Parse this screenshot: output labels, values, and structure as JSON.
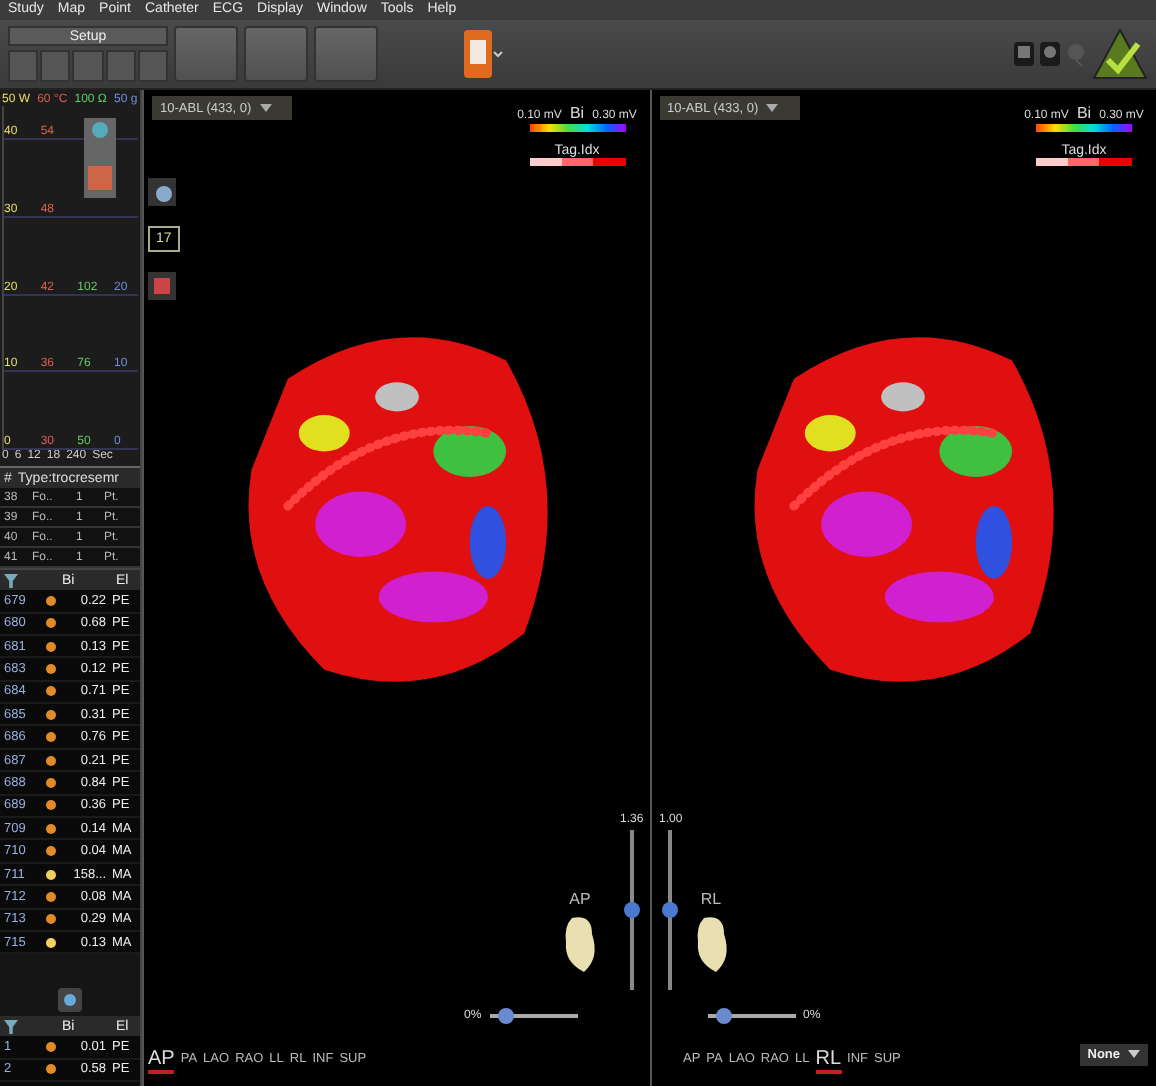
{
  "menu": [
    "Study",
    "Map",
    "Point",
    "Catheter",
    "ECG",
    "Display",
    "Window",
    "Tools",
    "Help"
  ],
  "toolbar": {
    "setup_label": "Setup"
  },
  "graph": {
    "top_labels": [
      "50 W",
      "60 °C",
      "100 Ω",
      "50 g"
    ],
    "rows": [
      [
        "40",
        "54",
        "",
        ""
      ],
      [
        "30",
        "48",
        "",
        ""
      ],
      [
        "20",
        "42",
        "102",
        "20"
      ],
      [
        "10",
        "36",
        "76",
        "10"
      ],
      [
        "0",
        "30",
        "50",
        "0"
      ]
    ],
    "x_labels": [
      "0",
      "6",
      "12",
      "18",
      "240",
      "Sec"
    ]
  },
  "point_list": {
    "columns": [
      "#",
      "Type:trocresemr"
    ],
    "rows": [
      {
        "num": "38",
        "type": "Fo..",
        "count": "1",
        "tag": "Pt."
      },
      {
        "num": "39",
        "type": "Fo..",
        "count": "1",
        "tag": "Pt."
      },
      {
        "num": "40",
        "type": "Fo..",
        "count": "1",
        "tag": "Pt."
      },
      {
        "num": "41",
        "type": "Fo..",
        "count": "1",
        "tag": "Pt."
      }
    ]
  },
  "table": {
    "columns": [
      "Bi",
      "El"
    ],
    "rows": [
      {
        "num": "679",
        "color": "#e08a2a",
        "bi": "0.22",
        "el": "PE"
      },
      {
        "num": "680",
        "color": "#e08a2a",
        "bi": "0.68",
        "el": "PE"
      },
      {
        "num": "681",
        "color": "#e08a2a",
        "bi": "0.13",
        "el": "PE"
      },
      {
        "num": "683",
        "color": "#e08a2a",
        "bi": "0.12",
        "el": "PE"
      },
      {
        "num": "684",
        "color": "#e08a2a",
        "bi": "0.71",
        "el": "PE"
      },
      {
        "num": "685",
        "color": "#e08a2a",
        "bi": "0.31",
        "el": "PE"
      },
      {
        "num": "686",
        "color": "#e08a2a",
        "bi": "0.76",
        "el": "PE"
      },
      {
        "num": "687",
        "color": "#e08a2a",
        "bi": "0.21",
        "el": "PE"
      },
      {
        "num": "688",
        "color": "#e08a2a",
        "bi": "0.84",
        "el": "PE"
      },
      {
        "num": "689",
        "color": "#e08a2a",
        "bi": "0.36",
        "el": "PE"
      },
      {
        "num": "709",
        "color": "#e08a2a",
        "bi": "0.14",
        "el": "MA"
      },
      {
        "num": "710",
        "color": "#e08a2a",
        "bi": "0.04",
        "el": "MA"
      },
      {
        "num": "711",
        "color": "#f0d060",
        "bi": "158...",
        "el": "MA"
      },
      {
        "num": "712",
        "color": "#e08a2a",
        "bi": "0.08",
        "el": "MA"
      },
      {
        "num": "713",
        "color": "#e08a2a",
        "bi": "0.29",
        "el": "MA"
      },
      {
        "num": "715",
        "color": "#f0d060",
        "bi": "0.13",
        "el": "MA"
      }
    ]
  },
  "table_2": {
    "columns": [
      "Bi",
      "El"
    ],
    "rows": [
      {
        "num": "1",
        "color": "#e08a2a",
        "bi": "0.01",
        "el": "PE"
      },
      {
        "num": "2",
        "color": "#e08a2a",
        "bi": "0.58",
        "el": "PE"
      }
    ]
  },
  "viewports": [
    {
      "selector": "10-ABL (433, 0)",
      "legend_min": "0.10 mV",
      "legend_name": "Bi",
      "legend_max": "0.30 mV",
      "tag_label": "Tag.Idx",
      "counter": "17",
      "zoom": "1.36",
      "zoom_slider": {
        "level": 0.45
      },
      "orientation": "AP",
      "opacity": "0%",
      "opacity_slider": {
        "level": 0.2
      },
      "views": [
        {
          "label": "AP",
          "selected": true
        },
        {
          "label": "PA",
          "selected": false
        },
        {
          "label": "LAO",
          "selected": false
        },
        {
          "label": "RAO",
          "selected": false
        },
        {
          "label": "LL",
          "selected": false
        },
        {
          "label": "RL",
          "selected": false
        },
        {
          "label": "INF",
          "selected": false
        },
        {
          "label": "SUP",
          "selected": false
        }
      ]
    },
    {
      "selector": "10-ABL (433, 0)",
      "legend_min": "0.10 mV",
      "legend_name": "Bi",
      "legend_max": "0.30 mV",
      "tag_label": "Tag.Idx",
      "zoom": "1.00",
      "zoom_slider": {
        "level": 0.45
      },
      "orientation": "RL",
      "opacity": "0%",
      "opacity_slider": {
        "level": 0.2
      },
      "views": [
        {
          "label": "AP",
          "selected": false
        },
        {
          "label": "PA",
          "selected": false
        },
        {
          "label": "LAO",
          "selected": false
        },
        {
          "label": "RAO",
          "selected": false
        },
        {
          "label": "LL",
          "selected": false
        },
        {
          "label": "RL",
          "selected": true
        },
        {
          "label": "INF",
          "selected": false
        },
        {
          "label": "SUP",
          "selected": false
        }
      ]
    }
  ],
  "layout_selector": "None"
}
